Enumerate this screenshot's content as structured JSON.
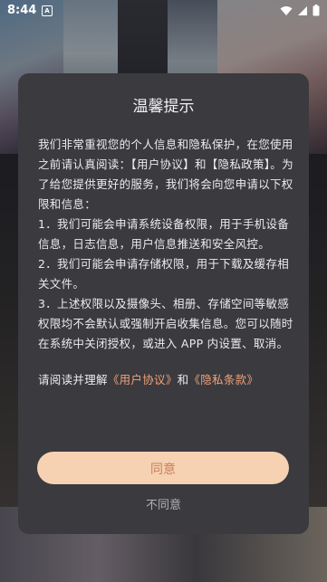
{
  "status_bar": {
    "time": "8:44",
    "app_icon_letter": "A",
    "icons": [
      "wifi-icon",
      "signal-icon",
      "battery-icon"
    ]
  },
  "dialog": {
    "title": "温馨提示",
    "paragraphs": [
      "我们非常重视您的个人信息和隐私保护，在您使用之前请认真阅读：【用户协议】和【隐私政策】。为了给您提供更好的服务，我们将会向您申请以下权限和信息：",
      "1．我们可能会申请系统设备权限，用于手机设备信息，日志信息，用户信息推送和安全风控。",
      "2．我们可能会申请存储权限，用于下载及缓存相关文件。",
      "3．上述权限以及摄像头、相册、存储空间等敏感权限均不会默认或强制开启收集信息。您可以随时在系统中关闭授权，或进入 APP 内设置、取消。"
    ],
    "read_prefix": "请阅读并理解",
    "user_agreement_link": "《用户协议》",
    "and_text": "和",
    "privacy_link": "《隐私条款》",
    "agree_label": "同意",
    "disagree_label": "不同意"
  },
  "colors": {
    "dialog_bg": "#3a3a3f",
    "accent_link": "#f0a27a",
    "agree_button_bg": "#f6d1b2",
    "agree_button_text": "#c9825d"
  }
}
